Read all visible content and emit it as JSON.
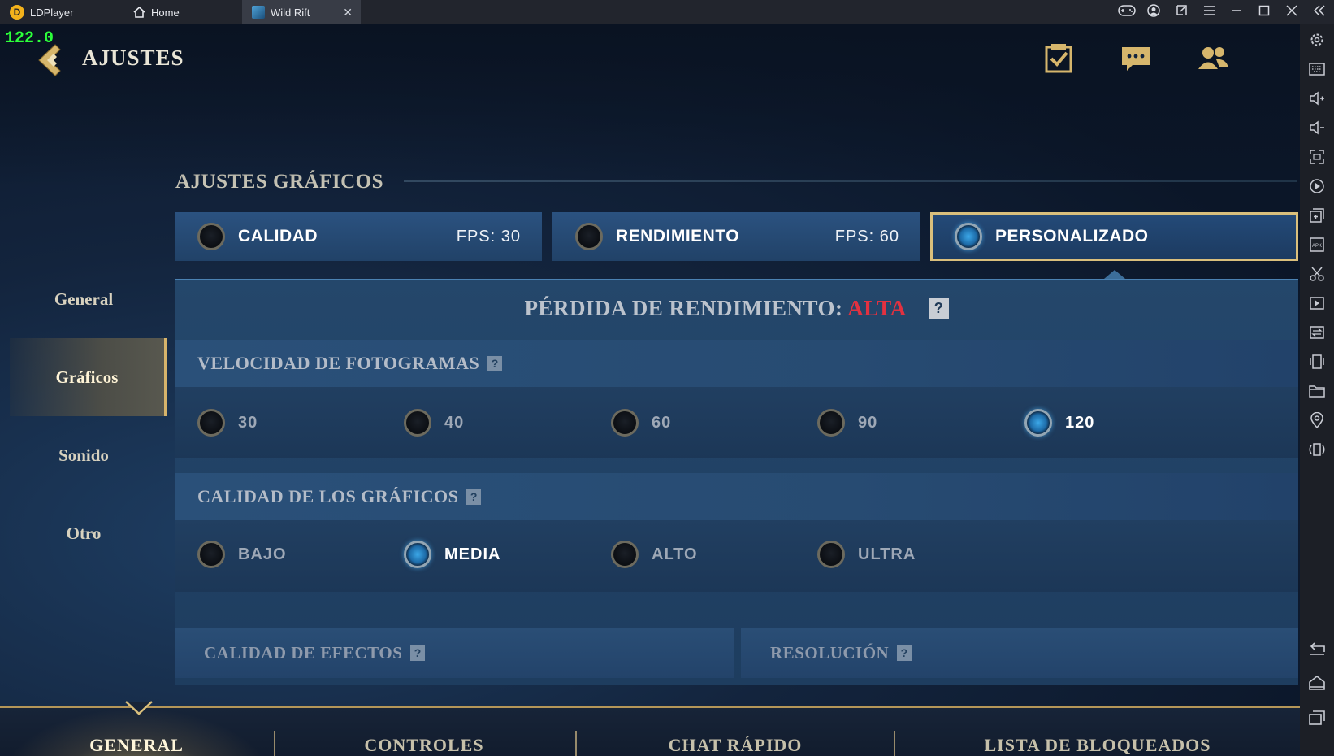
{
  "titlebar": {
    "app_name": "LDPlayer",
    "tabs": [
      {
        "label": "Home"
      },
      {
        "label": "Wild Rift"
      }
    ],
    "close_glyph": "✕"
  },
  "fps_counter": "122.0",
  "header": {
    "title": "AJUSTES",
    "icons": [
      "missions-icon",
      "chat-icon",
      "friends-icon"
    ]
  },
  "left_nav": {
    "items": [
      {
        "label": "General"
      },
      {
        "label": "Gráficos",
        "active": true
      },
      {
        "label": "Sonido"
      },
      {
        "label": "Otro"
      }
    ]
  },
  "section": {
    "title": "AJUSTES GRÁFICOS"
  },
  "presets": [
    {
      "label": "CALIDAD",
      "fps_label": "FPS:  30",
      "selected": false
    },
    {
      "label": "RENDIMIENTO",
      "fps_label": "FPS:  60",
      "selected": false
    },
    {
      "label": "PERSONALIZADO",
      "selected": true
    }
  ],
  "performance_loss": {
    "label": "PÉRDIDA DE RENDIMIENTO:",
    "value": "ALTA",
    "value_color": "#e23140"
  },
  "help_glyph": "?",
  "frame_rate": {
    "title": "VELOCIDAD DE FOTOGRAMAS",
    "options": [
      "30",
      "40",
      "60",
      "90",
      "120"
    ],
    "selected": "120"
  },
  "graphics_quality": {
    "title": "CALIDAD DE LOS GRÁFICOS",
    "options": [
      "BAJO",
      "MEDIA",
      "ALTO",
      "ULTRA"
    ],
    "selected": "MEDIA"
  },
  "effects_quality": {
    "title": "CALIDAD DE EFECTOS"
  },
  "resolution": {
    "title": "RESOLUCIÓN"
  },
  "bottom_tabs": [
    {
      "label": "GENERAL",
      "active": true
    },
    {
      "label": "CONTROLES"
    },
    {
      "label": "CHAT RÁPIDO"
    },
    {
      "label": "LISTA DE BLOQUEADOS"
    }
  ],
  "colors": {
    "accent_gold": "#d9bf7c",
    "selected_blue": "#3ca8e8",
    "fps_green": "#2cff3a"
  }
}
